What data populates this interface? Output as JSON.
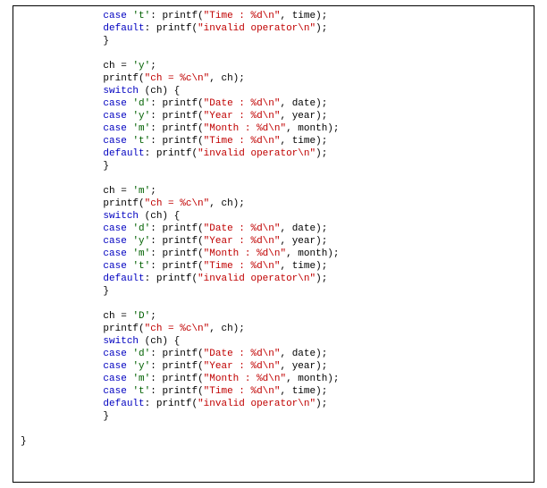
{
  "indent": {
    "lvl1": "       ",
    "lvl2": "              ",
    "close": "}"
  },
  "kw": {
    "case": "case",
    "default": "default",
    "switch": "switch"
  },
  "chars": {
    "t": "'t'",
    "d": "'d'",
    "y": "'y'",
    "m": "'m'",
    "D": "'D'"
  },
  "calls": {
    "printf": "printf",
    "ch_assign_y": "ch = 'y';",
    "ch_assign_m": "ch = 'm';",
    "ch_assign_D": "ch = 'D';",
    "switch_open": " (ch) {",
    "close_brace": "}"
  },
  "strings": {
    "time": "\"Time : %d\\n\"",
    "date": "\"Date : %d\\n\"",
    "year": "\"Year : %d\\n\"",
    "month": "\"Month : %d\\n\"",
    "invalid": "\"invalid operator\\n\"",
    "ch_fmt": "\"ch = %c\\n\""
  },
  "args": {
    "time": ", time);",
    "date": ", date);",
    "year": ", year);",
    "month": ", month);",
    "ch": ", ch);",
    "none": ");"
  },
  "punct": {
    "colon_sp": ": ",
    "open_paren": "("
  }
}
